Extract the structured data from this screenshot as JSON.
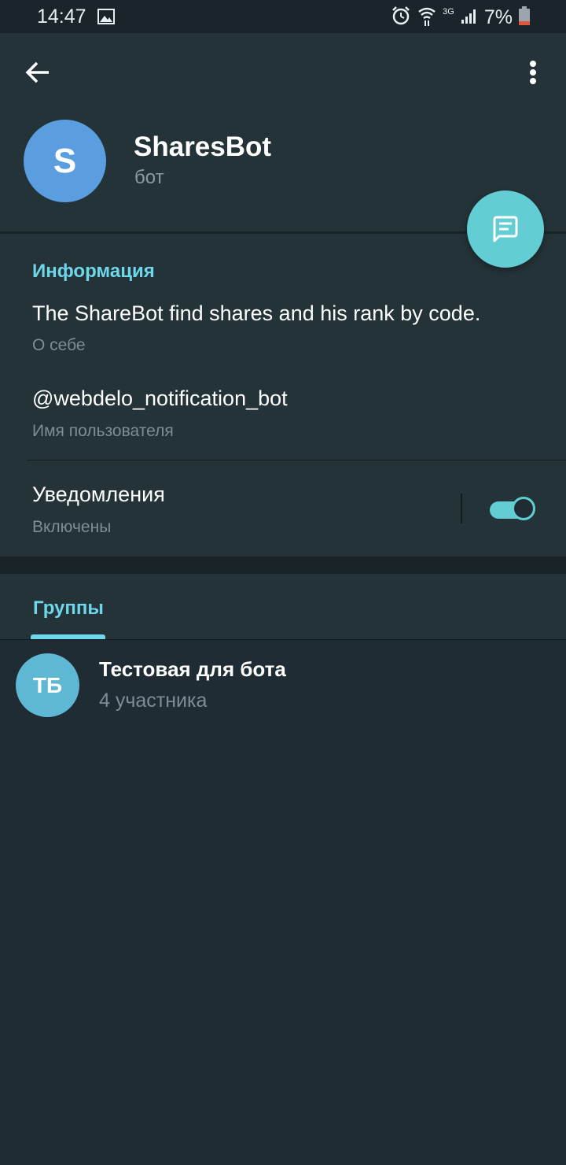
{
  "status_bar": {
    "time": "14:47",
    "battery_percent": "7%",
    "network": "3G",
    "icons": [
      "image-icon",
      "alarm-icon",
      "wifi-icon",
      "signal-icon",
      "battery-icon"
    ]
  },
  "header": {
    "avatar_letter": "S",
    "title": "SharesBot",
    "subtitle": "бот"
  },
  "info": {
    "section_title": "Информация",
    "about_value": "The ShareBot find shares and his rank by code.",
    "about_hint": "О себе",
    "username_value": "@webdelo_notification_bot",
    "username_hint": "Имя пользователя",
    "notifications_label": "Уведомления",
    "notifications_status": "Включены",
    "notifications_enabled": true
  },
  "tabs": {
    "active_label": "Группы"
  },
  "groups": [
    {
      "initials": "ТБ",
      "name": "Тестовая для бота",
      "members": "4 участника"
    }
  ],
  "colors": {
    "background": "#1f2c33",
    "header": "#243338",
    "accent": "#62cdd3",
    "accent_text": "#6ed7ea",
    "avatar_bot": "#5b9ee0",
    "avatar_group": "#5fb8d3"
  }
}
